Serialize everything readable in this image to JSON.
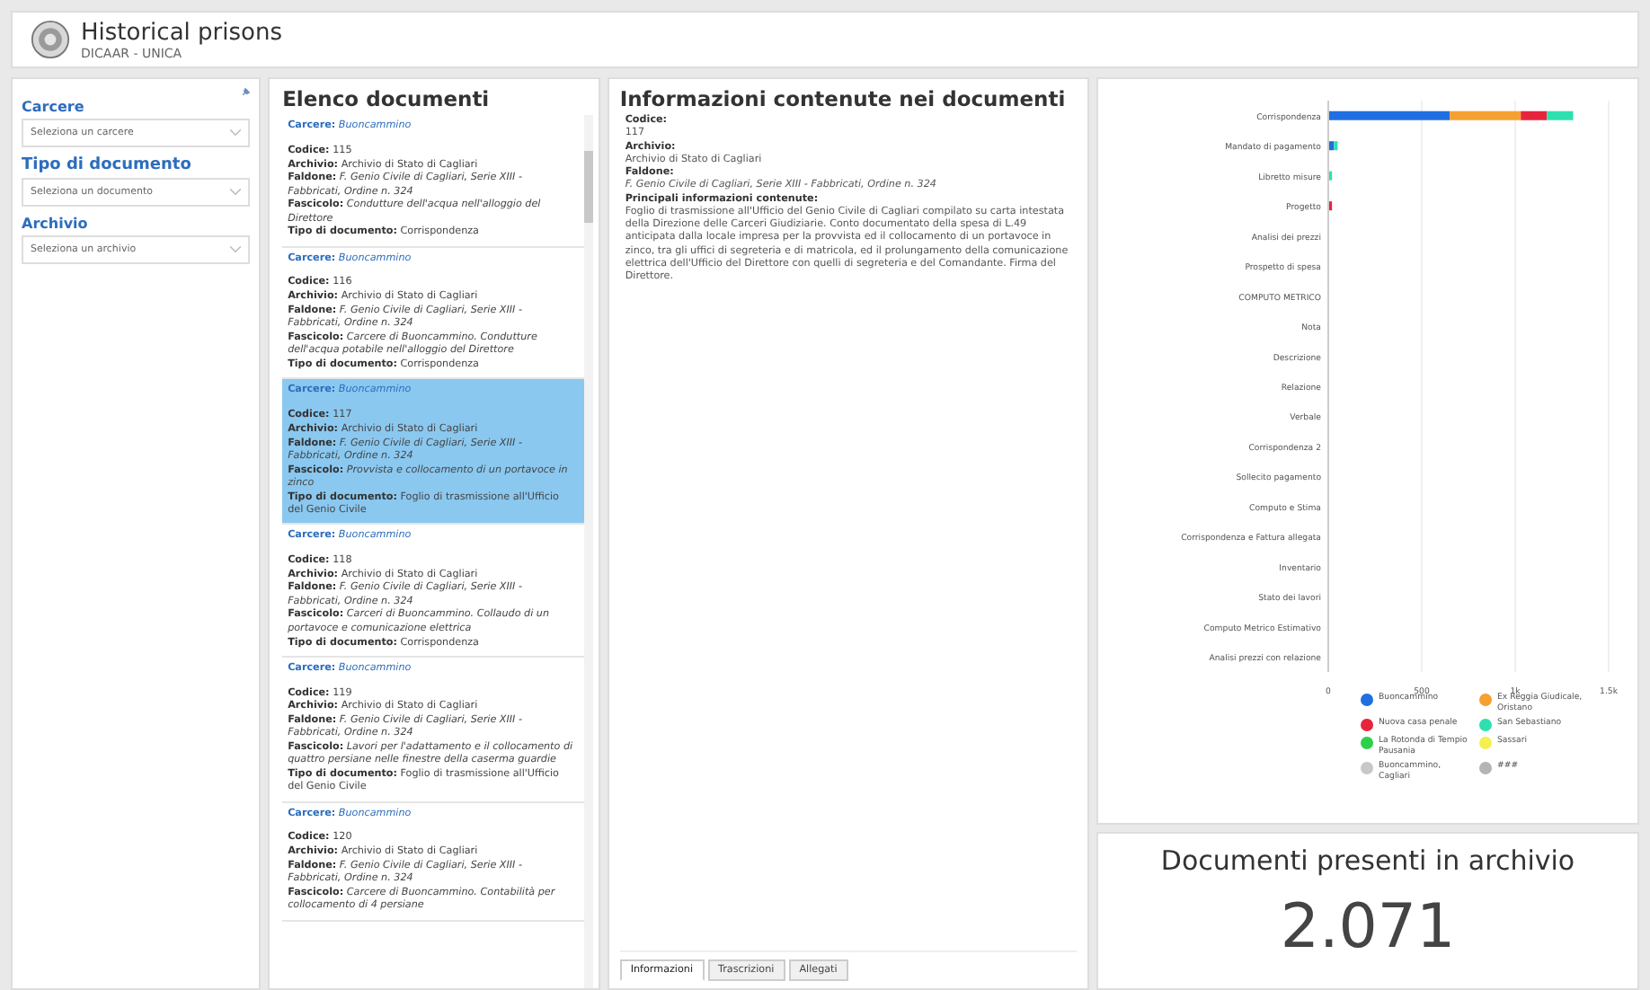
{
  "header": {
    "title": "Historical prisons",
    "subtitle": "DICAAR - UNICA"
  },
  "filters": [
    {
      "label": "Carcere",
      "placeholder": "Seleziona un carcere"
    },
    {
      "label": "Tipo di documento",
      "placeholder": "Seleziona un documento"
    },
    {
      "label": "Archivio",
      "placeholder": "Seleziona un archivio"
    }
  ],
  "list": {
    "title": "Elenco documenti",
    "items": [
      {
        "selected": false,
        "carcere_label": "Carcere:",
        "carcere": "Buoncammino",
        "fields": [
          {
            "label": "Codice:",
            "value": "115",
            "italic": false
          },
          {
            "label": "Archivio:",
            "value": "Archivio di Stato di Cagliari",
            "italic": false
          },
          {
            "label": "Faldone:",
            "value": "F. Genio Civile di Cagliari, Serie XIII - Fabbricati, Ordine n. 324",
            "italic": true
          },
          {
            "label": "Fascicolo:",
            "value": "Condutture dell'acqua nell'alloggio del Direttore",
            "italic": true
          },
          {
            "label": "Tipo di documento:",
            "value": "Corrispondenza",
            "italic": false
          }
        ]
      },
      {
        "selected": false,
        "carcere_label": "Carcere:",
        "carcere": "Buoncammino",
        "fields": [
          {
            "label": "Codice:",
            "value": "116",
            "italic": false
          },
          {
            "label": "Archivio:",
            "value": "Archivio di Stato di Cagliari",
            "italic": false
          },
          {
            "label": "Faldone:",
            "value": "F. Genio Civile di Cagliari, Serie XIII - Fabbricati, Ordine n. 324",
            "italic": true
          },
          {
            "label": "Fascicolo:",
            "value": "Carcere di Buoncammino. Condutture dell'acqua potabile nell'alloggio del Direttore",
            "italic": true
          },
          {
            "label": "Tipo di documento:",
            "value": "Corrispondenza",
            "italic": false
          }
        ]
      },
      {
        "selected": true,
        "carcere_label": "Carcere:",
        "carcere": "Buoncammino",
        "fields": [
          {
            "label": "Codice:",
            "value": "117",
            "italic": false
          },
          {
            "label": "Archivio:",
            "value": "Archivio di Stato di Cagliari",
            "italic": false
          },
          {
            "label": "Faldone:",
            "value": "F. Genio Civile di Cagliari, Serie XIII - Fabbricati, Ordine n. 324",
            "italic": true
          },
          {
            "label": "Fascicolo:",
            "value": "Provvista e collocamento di un portavoce in zinco",
            "italic": true
          },
          {
            "label": "Tipo di documento:",
            "value": "Foglio di trasmissione all'Ufficio del Genio Civile",
            "italic": false
          }
        ]
      },
      {
        "selected": false,
        "carcere_label": "Carcere:",
        "carcere": "Buoncammino",
        "fields": [
          {
            "label": "Codice:",
            "value": "118",
            "italic": false
          },
          {
            "label": "Archivio:",
            "value": "Archivio di Stato di Cagliari",
            "italic": false
          },
          {
            "label": "Faldone:",
            "value": "F. Genio Civile di Cagliari, Serie XIII - Fabbricati, Ordine n. 324",
            "italic": true
          },
          {
            "label": "Fascicolo:",
            "value": "Carceri di Buoncammino. Collaudo di un portavoce e comunicazione elettrica",
            "italic": true
          },
          {
            "label": "Tipo di documento:",
            "value": "Corrispondenza",
            "italic": false
          }
        ]
      },
      {
        "selected": false,
        "carcere_label": "Carcere:",
        "carcere": "Buoncammino",
        "fields": [
          {
            "label": "Codice:",
            "value": "119",
            "italic": false
          },
          {
            "label": "Archivio:",
            "value": "Archivio di Stato di Cagliari",
            "italic": false
          },
          {
            "label": "Faldone:",
            "value": "F. Genio Civile di Cagliari, Serie XIII - Fabbricati, Ordine n. 324",
            "italic": true
          },
          {
            "label": "Fascicolo:",
            "value": "Lavori per l'adattamento e il collocamento di quattro persiane nelle finestre della caserma guardie",
            "italic": true
          },
          {
            "label": "Tipo di documento:",
            "value": "Foglio di trasmissione all'Ufficio del Genio Civile",
            "italic": false
          }
        ]
      },
      {
        "selected": false,
        "carcere_label": "Carcere:",
        "carcere": "Buoncammino",
        "fields": [
          {
            "label": "Codice:",
            "value": "120",
            "italic": false
          },
          {
            "label": "Archivio:",
            "value": "Archivio di Stato di Cagliari",
            "italic": false
          },
          {
            "label": "Faldone:",
            "value": "F. Genio Civile di Cagliari, Serie XIII - Fabbricati, Ordine n. 324",
            "italic": true
          },
          {
            "label": "Fascicolo:",
            "value": "Carcere di Buoncammino. Contabilità per collocamento di 4 persiane",
            "italic": true
          }
        ]
      }
    ]
  },
  "info": {
    "title": "Informazioni contenute nei documenti",
    "fields": [
      {
        "label": "Codice:",
        "value": "117",
        "italic": false
      },
      {
        "label": "Archivio:",
        "value": "Archivio di Stato di Cagliari",
        "italic": false
      },
      {
        "label": "Faldone:",
        "value": "F. Genio Civile di Cagliari, Serie XIII - Fabbricati, Ordine n. 324",
        "italic": true
      },
      {
        "label": "Principali informazioni contenute:",
        "value": "Foglio di trasmissione all'Ufficio del Genio Civile di Cagliari compilato su carta intestata della Direzione delle Carceri Giudiziarie. Conto documentato della spesa di L.49 anticipata dalla locale impresa per la provvista ed il collocamento di un portavoce in zinco, tra gli uffici di segreteria e di matricola, ed il prolungamento della comunicazione elettrica dell'Ufficio del Direttore con quelli di segreteria e del Comandante. Firma del Direttore.",
        "italic": false
      }
    ],
    "tabs": [
      {
        "label": "Informazioni",
        "selected": true
      },
      {
        "label": "Trascrizioni",
        "selected": false
      },
      {
        "label": "Allegati",
        "selected": false
      }
    ]
  },
  "chart": {
    "chart_data": {
      "type": "bar",
      "orientation": "horizontal",
      "stacked": true,
      "categories": [
        "Corrispondenza",
        "Mandato di pagamento",
        "Libretto misure",
        "Progetto",
        "Analisi dei prezzi",
        "Prospetto di spesa",
        "COMPUTO METRICO",
        "Nota",
        "Descrizione",
        "Relazione",
        "Verbale",
        "Corrispondenza 2",
        "Sollecito pagamento",
        "Computo e Stima",
        "Corrispondenza e Fattura allegata",
        "Inventario",
        "Stato dei lavori",
        "Computo Metrico Estimativo",
        "Analisi prezzi con relazione"
      ],
      "xlim": [
        0,
        1500
      ],
      "xticks": [
        0,
        {
          "value": 500,
          "label": "500"
        },
        {
          "value": 1000,
          "label": "1k"
        },
        {
          "value": 1500,
          "label": "1.5k"
        }
      ],
      "series": [
        {
          "name": "Buoncammino",
          "color": "#1f6fe0",
          "values": [
            650,
            30,
            null,
            null,
            null,
            null,
            null,
            null,
            null,
            null,
            null,
            null,
            null,
            null,
            null,
            null,
            null,
            null,
            null
          ]
        },
        {
          "name": "Ex Reggia Giudicale, Oristano",
          "color": "#f5a030",
          "values": [
            380,
            null,
            null,
            null,
            null,
            null,
            null,
            null,
            null,
            null,
            null,
            null,
            null,
            null,
            null,
            null,
            null,
            null,
            null
          ]
        },
        {
          "name": "Nuova casa penale",
          "color": "#e8243c",
          "values": [
            140,
            null,
            null,
            20,
            null,
            null,
            null,
            null,
            null,
            null,
            null,
            null,
            null,
            null,
            null,
            null,
            null,
            null,
            null
          ]
        },
        {
          "name": "San Sebastiano",
          "color": "#2ee0b0",
          "values": [
            140,
            20,
            20,
            null,
            null,
            null,
            null,
            null,
            null,
            null,
            null,
            null,
            null,
            null,
            null,
            null,
            null,
            null,
            null
          ]
        },
        {
          "name": "La Rotonda di Tempio Pausania",
          "color": "#2ed04a",
          "values": [
            null,
            null,
            null,
            null,
            null,
            null,
            null,
            null,
            null,
            null,
            null,
            null,
            null,
            null,
            null,
            null,
            null,
            null,
            null
          ]
        },
        {
          "name": "Sassari",
          "color": "#f5ef50",
          "values": [
            null,
            null,
            null,
            null,
            null,
            null,
            null,
            null,
            null,
            null,
            null,
            null,
            null,
            null,
            null,
            null,
            null,
            null,
            null
          ]
        },
        {
          "name": "Buoncammino, Cagliari",
          "color": "#c8c8c8",
          "values": [
            null,
            null,
            null,
            null,
            null,
            null,
            null,
            null,
            null,
            null,
            null,
            null,
            null,
            null,
            null,
            null,
            null,
            null,
            null
          ]
        },
        {
          "name": "###",
          "color": "#b4b4b4",
          "values": [
            null,
            null,
            null,
            null,
            null,
            null,
            null,
            null,
            null,
            null,
            null,
            null,
            null,
            null,
            null,
            null,
            null,
            null,
            null
          ]
        }
      ]
    }
  },
  "counter": {
    "title": "Documenti presenti in archivio",
    "value": "2.071"
  }
}
